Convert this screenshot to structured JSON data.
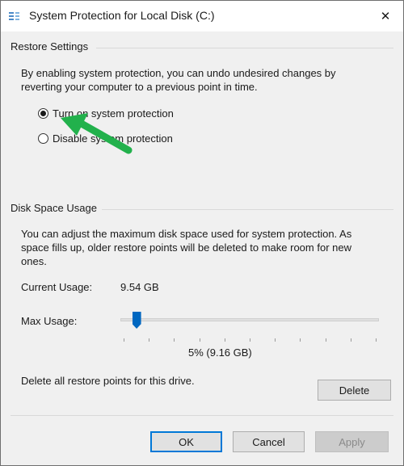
{
  "window": {
    "title": "System Protection for Local Disk (C:)",
    "close_glyph": "✕"
  },
  "restore_settings": {
    "title": "Restore Settings",
    "description": "By enabling system protection, you can undo undesired changes by reverting your computer to a previous point in time.",
    "options": [
      {
        "label": "Turn on system protection",
        "selected": true
      },
      {
        "label": "Disable system protection",
        "selected": false
      }
    ]
  },
  "disk_space": {
    "title": "Disk Space Usage",
    "description": "You can adjust the maximum disk space used for system protection. As space fills up, older restore points will be deleted to make room for new ones.",
    "current_usage_label": "Current Usage:",
    "current_usage_value": "9.54 GB",
    "max_usage_label": "Max Usage:",
    "max_usage_percent": 5,
    "max_usage_readout": "5% (9.16 GB)",
    "delete_text": "Delete all restore points for this drive.",
    "delete_label": "Delete"
  },
  "footer": {
    "ok_label": "OK",
    "cancel_label": "Cancel",
    "apply_label": "Apply"
  },
  "colors": {
    "accent": "#0078d7",
    "annotation_arrow": "#22b14c"
  }
}
